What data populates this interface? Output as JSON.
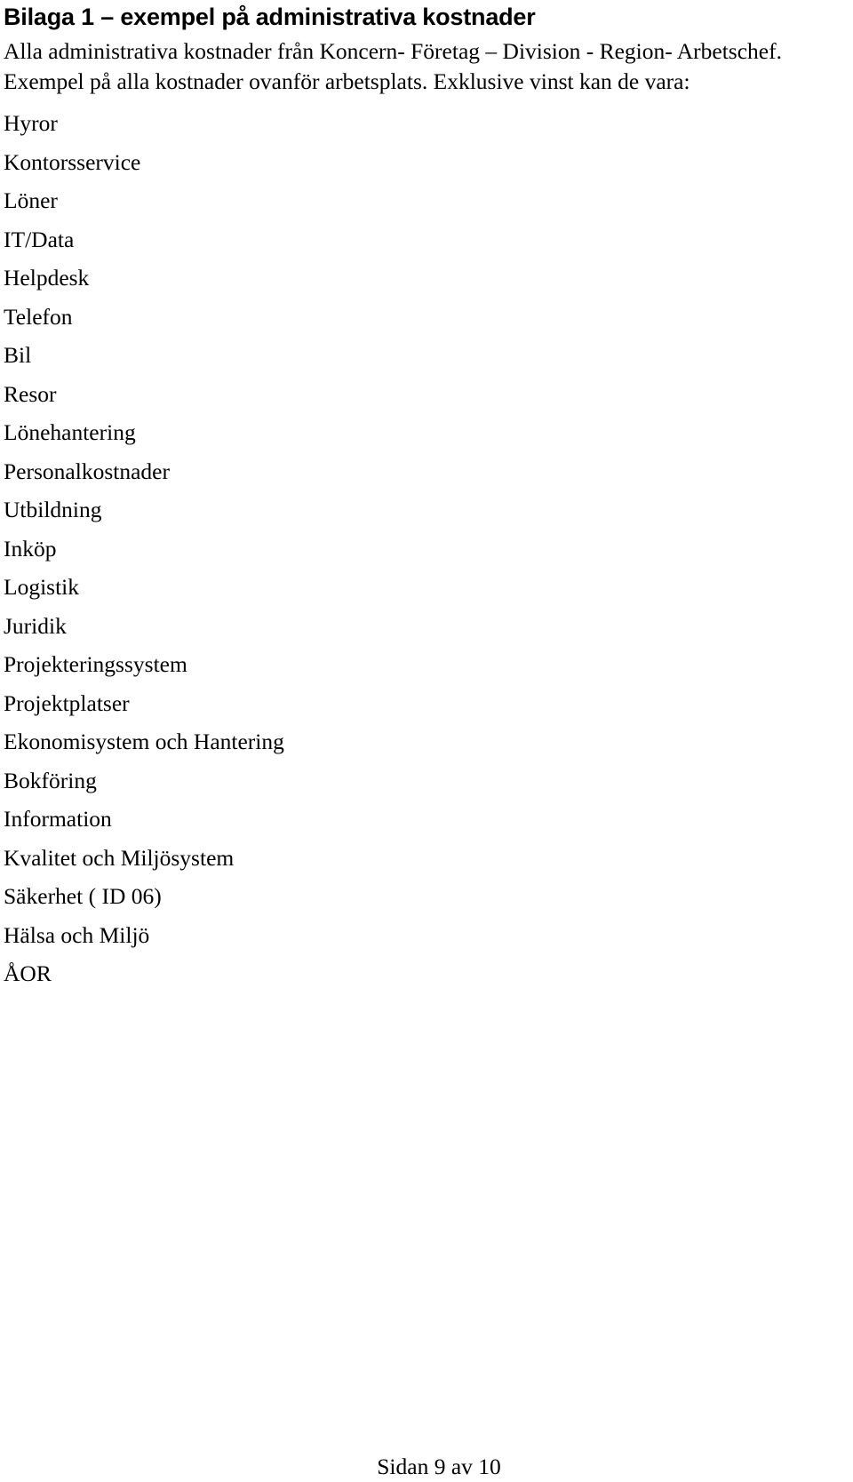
{
  "document": {
    "heading": "Bilaga 1 – exempel på administrativa kostnader",
    "intro": "Alla administrativa kostnader från Koncern- Företag – Division - Region- Arbetschef. Exempel på alla kostnader ovanför arbetsplats. Exklusive vinst kan de vara:",
    "cost_items": [
      "Hyror",
      "Kontorsservice",
      "Löner",
      "IT/Data",
      "Helpdesk",
      "Telefon",
      "Bil",
      "Resor",
      "Lönehantering",
      "Personalkostnader",
      "Utbildning",
      "Inköp",
      "Logistik",
      "Juridik",
      "Projekteringssystem",
      "Projektplatser",
      "Ekonomisystem och Hantering",
      "Bokföring",
      "Information",
      "Kvalitet och Miljösystem",
      "Säkerhet ( ID 06)",
      "Hälsa och Miljö",
      "ÅOR"
    ],
    "footer": "Sidan 9 av 10"
  }
}
